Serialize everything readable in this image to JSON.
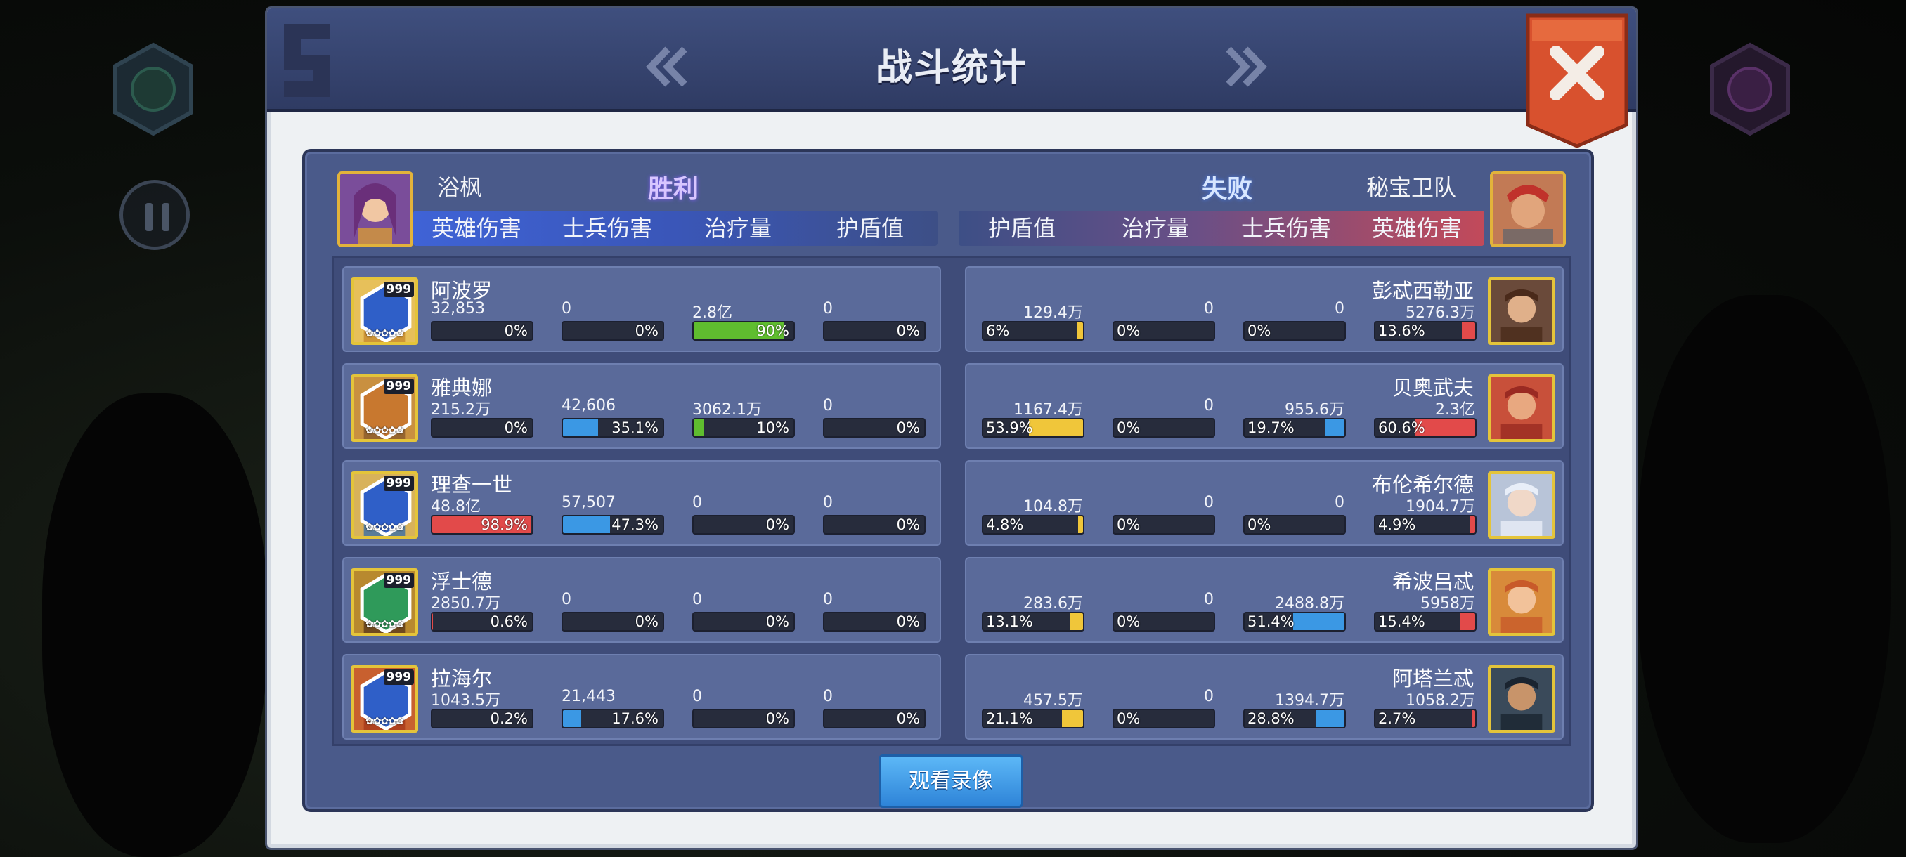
{
  "title": "战斗统计",
  "watch_button": "观看录像",
  "icons": {
    "close": "close-icon",
    "prev": "double-chevron-left-icon",
    "next": "double-chevron-right-icon",
    "pause": "pause-icon"
  },
  "colors": {
    "hero_damage": "#e24a4a",
    "soldier_damage": "#3b98e4",
    "healing": "#5fbd2f",
    "shield": "#f0c63a",
    "win_header": "#3e5fcf",
    "lose_header": "#c34a5a",
    "win_text": "#dcd4ff",
    "lose_text": "#d7e6ff"
  },
  "left": {
    "player": "浴枫",
    "result": "胜利",
    "columns": [
      "英雄伤害",
      "士兵伤害",
      "治疗量",
      "护盾值"
    ],
    "heroes": [
      {
        "name": "阿波罗",
        "level": "999",
        "stats": [
          {
            "value": "32,853",
            "pct": "0%",
            "ratio": 0
          },
          {
            "value": "0",
            "pct": "0%",
            "ratio": 0
          },
          {
            "value": "2.8亿",
            "pct": "90%",
            "ratio": 0.9
          },
          {
            "value": "0",
            "pct": "0%",
            "ratio": 0
          }
        ]
      },
      {
        "name": "雅典娜",
        "level": "999",
        "stats": [
          {
            "value": "215.2万",
            "pct": "0%",
            "ratio": 0
          },
          {
            "value": "42,606",
            "pct": "35.1%",
            "ratio": 0.351
          },
          {
            "value": "3062.1万",
            "pct": "10%",
            "ratio": 0.1
          },
          {
            "value": "0",
            "pct": "0%",
            "ratio": 0
          }
        ]
      },
      {
        "name": "理查一世",
        "level": "999",
        "stats": [
          {
            "value": "48.8亿",
            "pct": "98.9%",
            "ratio": 0.989
          },
          {
            "value": "57,507",
            "pct": "47.3%",
            "ratio": 0.473
          },
          {
            "value": "0",
            "pct": "0%",
            "ratio": 0
          },
          {
            "value": "0",
            "pct": "0%",
            "ratio": 0
          }
        ]
      },
      {
        "name": "浮士德",
        "level": "999",
        "stats": [
          {
            "value": "2850.7万",
            "pct": "0.6%",
            "ratio": 0.006
          },
          {
            "value": "0",
            "pct": "0%",
            "ratio": 0
          },
          {
            "value": "0",
            "pct": "0%",
            "ratio": 0
          },
          {
            "value": "0",
            "pct": "0%",
            "ratio": 0
          }
        ]
      },
      {
        "name": "拉海尔",
        "level": "999",
        "stats": [
          {
            "value": "1043.5万",
            "pct": "0.2%",
            "ratio": 0.002
          },
          {
            "value": "21,443",
            "pct": "17.6%",
            "ratio": 0.176
          },
          {
            "value": "0",
            "pct": "0%",
            "ratio": 0
          },
          {
            "value": "0",
            "pct": "0%",
            "ratio": 0
          }
        ]
      }
    ]
  },
  "right": {
    "player": "秘宝卫队",
    "result": "失败",
    "columns": [
      "护盾值",
      "治疗量",
      "士兵伤害",
      "英雄伤害"
    ],
    "heroes": [
      {
        "name": "彭忒西勒亚",
        "stats": [
          {
            "value": "129.4万",
            "pct": "6%",
            "ratio": 0.06
          },
          {
            "value": "0",
            "pct": "0%",
            "ratio": 0
          },
          {
            "value": "0",
            "pct": "0%",
            "ratio": 0
          },
          {
            "value": "5276.3万",
            "pct": "13.6%",
            "ratio": 0.136
          }
        ]
      },
      {
        "name": "贝奥武夫",
        "stats": [
          {
            "value": "1167.4万",
            "pct": "53.9%",
            "ratio": 0.539
          },
          {
            "value": "0",
            "pct": "0%",
            "ratio": 0
          },
          {
            "value": "955.6万",
            "pct": "19.7%",
            "ratio": 0.197
          },
          {
            "value": "2.3亿",
            "pct": "60.6%",
            "ratio": 0.606
          }
        ]
      },
      {
        "name": "布伦希尔德",
        "stats": [
          {
            "value": "104.8万",
            "pct": "4.8%",
            "ratio": 0.048
          },
          {
            "value": "0",
            "pct": "0%",
            "ratio": 0
          },
          {
            "value": "0",
            "pct": "0%",
            "ratio": 0
          },
          {
            "value": "1904.7万",
            "pct": "4.9%",
            "ratio": 0.049
          }
        ]
      },
      {
        "name": "希波吕忒",
        "stats": [
          {
            "value": "283.6万",
            "pct": "13.1%",
            "ratio": 0.131
          },
          {
            "value": "0",
            "pct": "0%",
            "ratio": 0
          },
          {
            "value": "2488.8万",
            "pct": "51.4%",
            "ratio": 0.514
          },
          {
            "value": "5958万",
            "pct": "15.4%",
            "ratio": 0.154
          }
        ]
      },
      {
        "name": "阿塔兰忒",
        "stats": [
          {
            "value": "457.5万",
            "pct": "21.1%",
            "ratio": 0.211
          },
          {
            "value": "0",
            "pct": "0%",
            "ratio": 0
          },
          {
            "value": "1394.7万",
            "pct": "28.8%",
            "ratio": 0.288
          },
          {
            "value": "1058.2万",
            "pct": "2.7%",
            "ratio": 0.027
          }
        ]
      }
    ]
  }
}
